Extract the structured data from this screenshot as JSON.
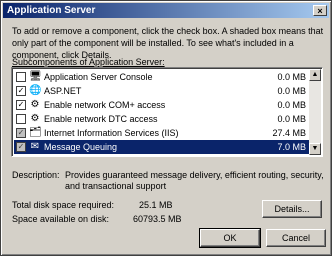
{
  "window": {
    "title": "Application Server",
    "close_glyph": "×"
  },
  "intro_text": "To add or remove a component, click the check box. A shaded box means that only part of the component will be installed. To see what's included in a component, click Details.",
  "subcomponents_label": "Subcomponents of Application Server:",
  "components": [
    {
      "name": "Application Server Console",
      "size": "0.0 MB",
      "checked": false,
      "icon": "console-icon"
    },
    {
      "name": "ASP.NET",
      "size": "0.0 MB",
      "checked": true,
      "icon": "aspnet-icon"
    },
    {
      "name": "Enable network COM+ access",
      "size": "0.0 MB",
      "checked": true,
      "icon": "complus-icon"
    },
    {
      "name": "Enable network DTC access",
      "size": "0.0 MB",
      "checked": false,
      "icon": "dtc-icon"
    },
    {
      "name": "Internet Information Services (IIS)",
      "size": "27.4 MB",
      "checked": true,
      "shaded": true,
      "icon": "iis-icon"
    },
    {
      "name": "Message Queuing",
      "size": "7.0 MB",
      "checked": true,
      "shaded": true,
      "selected": true,
      "icon": "message-queuing-icon"
    }
  ],
  "description": {
    "label": "Description:",
    "text": "Provides guaranteed message delivery, efficient routing, security, and transactional support"
  },
  "disk": {
    "required_label": "Total disk space required:",
    "required_value": "25.1 MB",
    "available_label": "Space available on disk:",
    "available_value": "60793.5 MB"
  },
  "buttons": {
    "details": "Details...",
    "ok": "OK",
    "cancel": "Cancel"
  },
  "colors": {
    "selection": "#0a246a",
    "dialog": "#d4d0c8"
  }
}
